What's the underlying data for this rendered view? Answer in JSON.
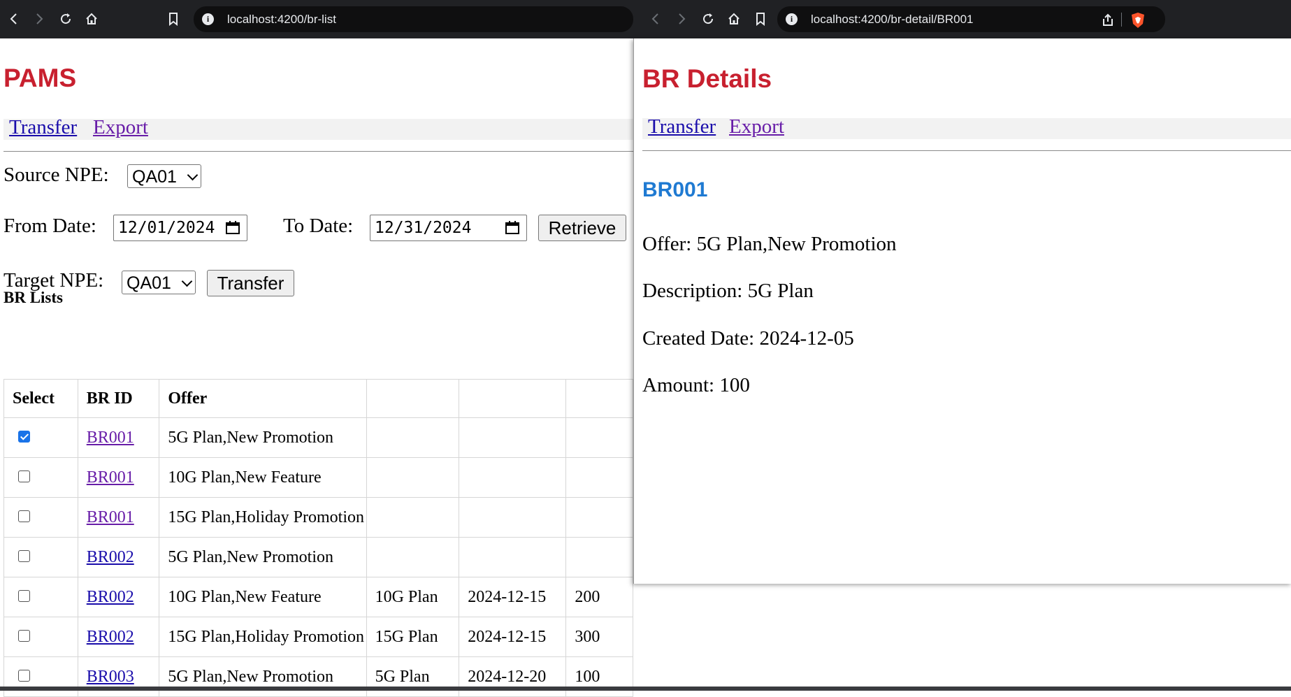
{
  "left_browser": {
    "url": "localhost:4200/br-list"
  },
  "right_browser": {
    "url": "localhost:4200/br-detail/BR001"
  },
  "list_page": {
    "app_title": "PAMS",
    "nav": {
      "transfer": "Transfer",
      "export": "Export"
    },
    "source_npe_label": "Source NPE:",
    "source_npe_value": "QA01",
    "from_date_label": "From Date:",
    "from_date_value": "12/01/2024",
    "to_date_label": "To Date:",
    "to_date_value": "12/31/2024",
    "retrieve_button": "Retrieve",
    "target_npe_label": "Target NPE:",
    "target_npe_value": "QA01",
    "transfer_button": "Transfer",
    "section_heading": "BR Lists",
    "table": {
      "headers": [
        "Select",
        "BR ID",
        "Offer"
      ],
      "rows": [
        {
          "checked": true,
          "br_id": "BR001",
          "offer": "5G Plan,New Promotion",
          "description": "",
          "created": "",
          "amount": ""
        },
        {
          "checked": false,
          "br_id": "BR001",
          "offer": "10G Plan,New Feature",
          "description": "",
          "created": "",
          "amount": ""
        },
        {
          "checked": false,
          "br_id": "BR001",
          "offer": "15G Plan,Holiday Promotion",
          "description": "",
          "created": "",
          "amount": ""
        },
        {
          "checked": false,
          "br_id": "BR002",
          "offer": "5G Plan,New Promotion",
          "description": "",
          "created": "",
          "amount": ""
        },
        {
          "checked": false,
          "br_id": "BR002",
          "offer": "10G Plan,New Feature",
          "description": "10G Plan",
          "created": "2024-12-15",
          "amount": "200"
        },
        {
          "checked": false,
          "br_id": "BR002",
          "offer": "15G Plan,Holiday Promotion",
          "description": "15G Plan",
          "created": "2024-12-15",
          "amount": "300"
        },
        {
          "checked": false,
          "br_id": "BR003",
          "offer": "5G Plan,New Promotion",
          "description": "5G Plan",
          "created": "2024-12-20",
          "amount": "100"
        }
      ]
    }
  },
  "detail_page": {
    "app_title": "BR Details",
    "nav": {
      "transfer": "Transfer",
      "export": "Export"
    },
    "br_id": "BR001",
    "offer": "Offer: 5G Plan,New Promotion",
    "description": "Description: 5G Plan",
    "created_date": "Created Date: 2024-12-05",
    "amount": "Amount: 100"
  },
  "colors": {
    "title_red": "#c8202f",
    "id_blue": "#1f7ad2",
    "link_blue": "#1a0dab",
    "link_visited": "#681da8",
    "chrome_dark": "#202124"
  }
}
